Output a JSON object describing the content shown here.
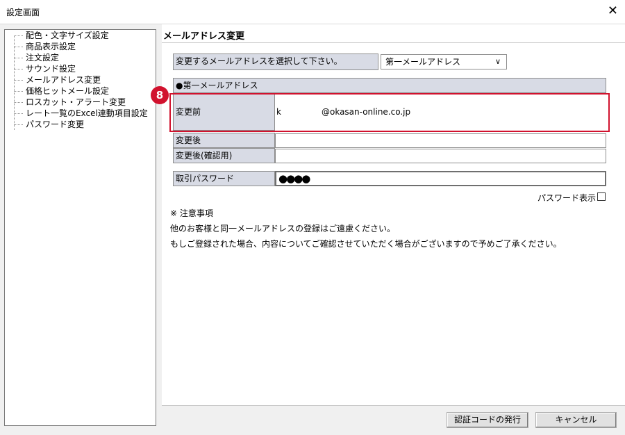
{
  "window": {
    "title": "設定画面"
  },
  "tree": {
    "items": [
      "配色・文字サイズ設定",
      "商品表示設定",
      "注文設定",
      "サウンド設定",
      "メールアドレス変更",
      "価格ヒットメール設定",
      "ロスカット・アラート変更",
      "レート一覧のExcel連動項目設定",
      "パスワード変更"
    ]
  },
  "main": {
    "section_title": "メールアドレス変更",
    "select_prompt": "変更するメールアドレスを選択して下さい。",
    "select_value": "第一メールアドレス",
    "group_header": "●第一メールアドレス",
    "before_label": "変更前",
    "before_value_prefix": "k",
    "before_value_domain": "@okasan-online.co.jp",
    "after_label": "変更後",
    "after_confirm_label": "変更後(確認用)",
    "password_label": "取引パスワード",
    "password_value": "●●●●",
    "show_password_label": "パスワード表示",
    "badge": "8",
    "notes": {
      "heading": "※ 注意事項",
      "line1": "他のお客様と同一メールアドレスの登録はご遠慮ください。",
      "line2": "もしご登録された場合、内容についてご確認させていただく場合がございますので予めご了承ください。"
    }
  },
  "buttons": {
    "issue_code": "認証コードの発行",
    "cancel": "キャンセル"
  },
  "colors": {
    "accent_red": "#d1122e",
    "label_bg": "#d8dbe5"
  }
}
